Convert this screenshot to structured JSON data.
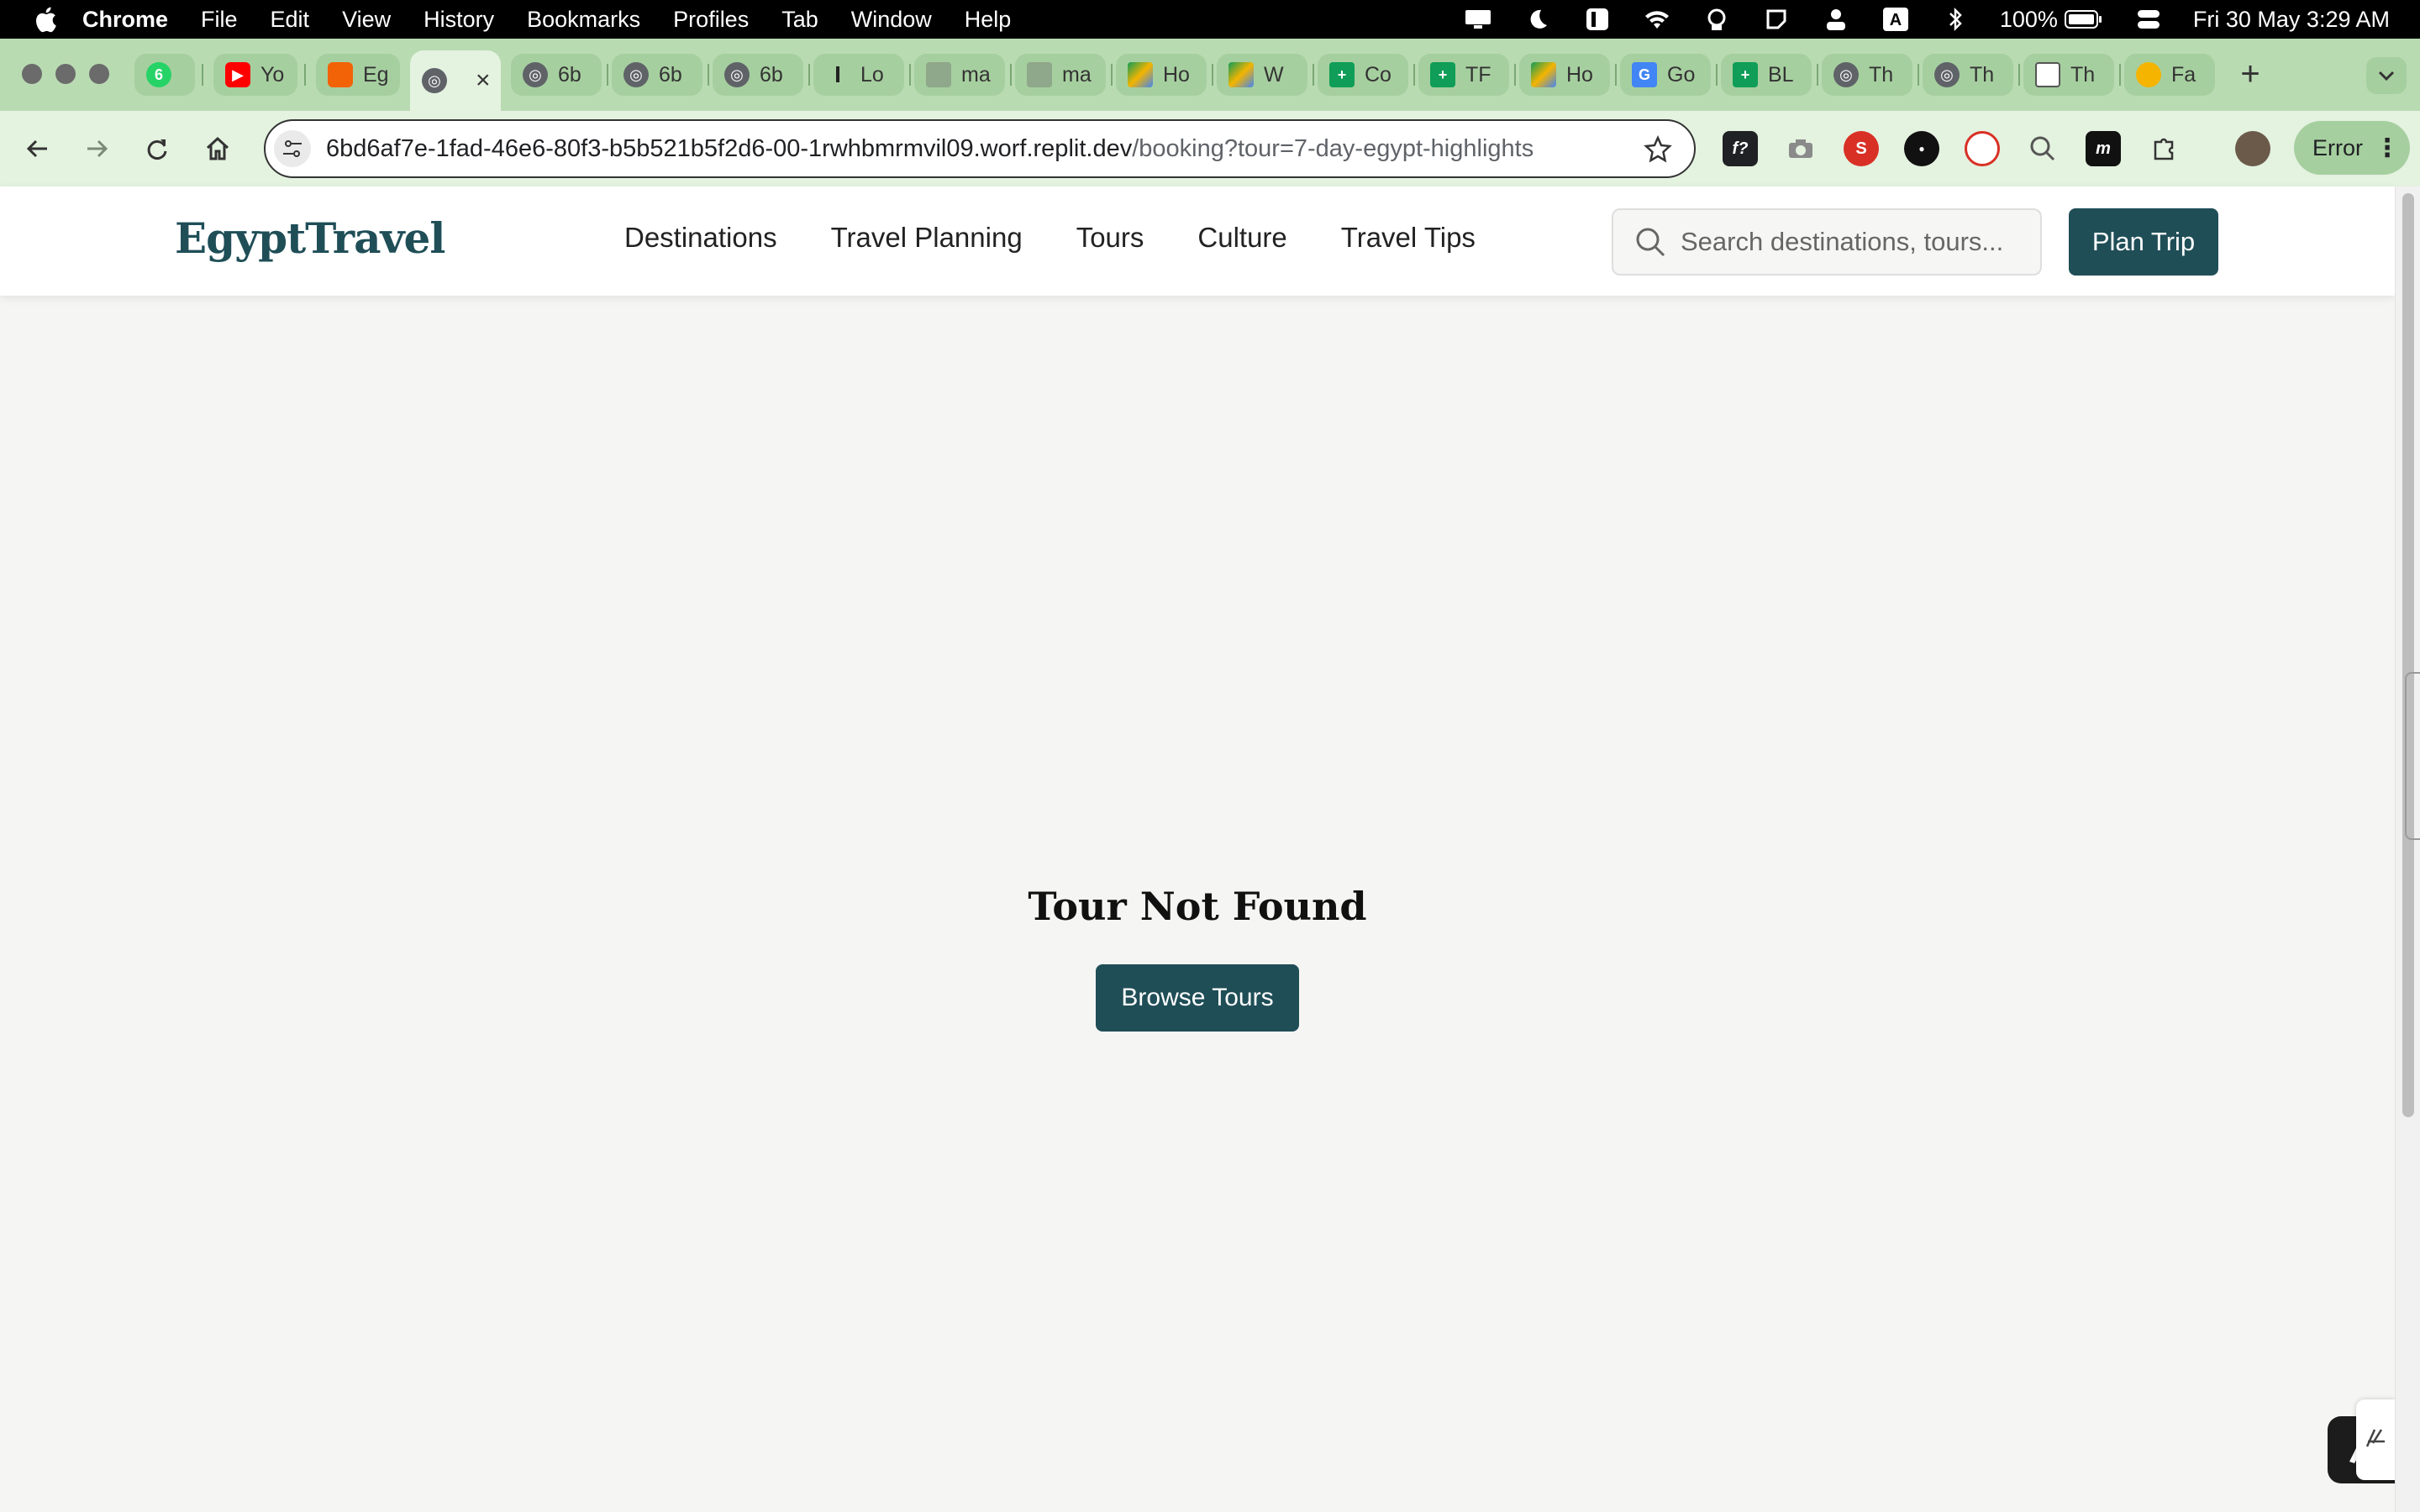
{
  "menubar": {
    "app": "Chrome",
    "items": [
      "File",
      "Edit",
      "View",
      "History",
      "Bookmarks",
      "Profiles",
      "Tab",
      "Window",
      "Help"
    ],
    "battery": "100%",
    "datetime": "Fri 30 May  3:29 AM",
    "input_source": "A"
  },
  "tabs": [
    {
      "label": "",
      "favicon": "whatsapp-icon",
      "badge": "6",
      "color": "#25d366"
    },
    {
      "label": "Yo",
      "favicon": "youtube-icon",
      "color": "#ff0000"
    },
    {
      "label": "Eg",
      "favicon": "replit-icon",
      "color": "#f26207"
    },
    {
      "label": "",
      "favicon": "globe-icon",
      "active": true
    },
    {
      "label": "6b",
      "favicon": "globe-icon"
    },
    {
      "label": "6b",
      "favicon": "globe-icon"
    },
    {
      "label": "6b",
      "favicon": "globe-icon"
    },
    {
      "label": "Lo",
      "favicon": "l-icon"
    },
    {
      "label": "ma",
      "favicon": "mail-icon"
    },
    {
      "label": "ma",
      "favicon": "mail-icon"
    },
    {
      "label": "Ho",
      "favicon": "drive-icon"
    },
    {
      "label": "W",
      "favicon": "drive-icon"
    },
    {
      "label": "Co",
      "favicon": "sheets-icon"
    },
    {
      "label": "TF",
      "favicon": "sheets-icon"
    },
    {
      "label": "Ho",
      "favicon": "drive-icon"
    },
    {
      "label": "Go",
      "favicon": "translate-icon"
    },
    {
      "label": "BL",
      "favicon": "sheets-icon"
    },
    {
      "label": "Th",
      "favicon": "globe-icon"
    },
    {
      "label": "Th",
      "favicon": "globe-icon"
    },
    {
      "label": "Th",
      "favicon": "calendar-icon"
    },
    {
      "label": "Fa",
      "favicon": "emoji-icon"
    }
  ],
  "addressbar": {
    "host": "6bd6af7e-1fad-46e6-80f3-b5b521b5f2d6-00-1rwhbmrmvil09.worf.replit.dev",
    "path": "/booking?tour=7-day-egypt-highlights"
  },
  "profile_chip": {
    "label": "Error"
  },
  "site": {
    "logo": "EgyptTravel",
    "nav": [
      "Destinations",
      "Travel Planning",
      "Tours",
      "Culture",
      "Travel Tips"
    ],
    "search_placeholder": "Search destinations, tours...",
    "plan_button": "Plan Trip"
  },
  "main": {
    "heading": "Tour Not Found",
    "browse_button": "Browse Tours"
  },
  "colors": {
    "brand": "#1f4e57",
    "chrome_frame": "#b9dbb2",
    "page_bg": "#f5f5f3"
  }
}
